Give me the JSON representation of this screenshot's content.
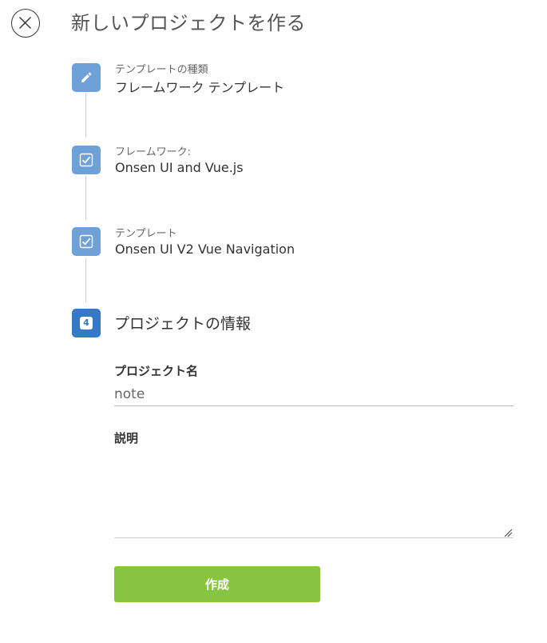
{
  "header": {
    "close_icon": "close-circle-icon",
    "title": "新しいプロジェクトを作る"
  },
  "steps": [
    {
      "icon": "pencil-icon",
      "label": "テンプレートの種類",
      "value": "フレームワーク テンプレート"
    },
    {
      "icon": "checkbox-checked-icon",
      "label": "フレームワーク:",
      "value": "Onsen UI and Vue.js"
    },
    {
      "icon": "checkbox-checked-icon",
      "label": "テンプレート",
      "value": "Onsen UI V2 Vue Navigation"
    },
    {
      "number": "4",
      "heading": "プロジェクトの情報"
    }
  ],
  "form": {
    "project_name_label": "プロジェクト名",
    "project_name_value": "note",
    "description_label": "説明",
    "description_value": "",
    "create_label": "作成"
  },
  "colors": {
    "completed_step": "#6fa1d9",
    "active_step": "#3478c6",
    "create_button": "#87c540"
  }
}
